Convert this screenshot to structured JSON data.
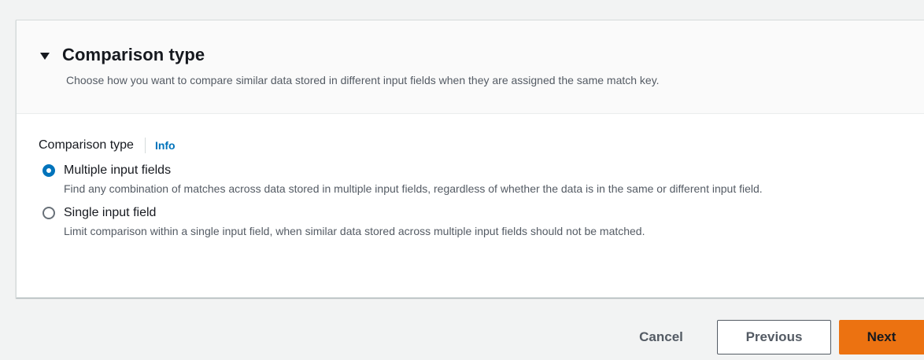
{
  "section": {
    "title": "Comparison type",
    "description": "Choose how you want to compare similar data stored in different input fields when they are assigned the same match key.",
    "expanded": true,
    "caret_icon": "caret-down-icon"
  },
  "field": {
    "label": "Comparison type",
    "info_link": "Info",
    "options": [
      {
        "label": "Multiple input fields",
        "description": "Find any combination of matches across data stored in multiple input fields, regardless of whether the data is in the same or different input field.",
        "selected": true
      },
      {
        "label": "Single input field",
        "description": "Limit comparison within a single input field, when similar data stored across multiple input fields should not be matched.",
        "selected": false
      }
    ]
  },
  "footer": {
    "cancel_label": "Cancel",
    "previous_label": "Previous",
    "next_label": "Next"
  },
  "colors": {
    "primary_button": "#ec7211",
    "link": "#0073bb",
    "radio_selected": "#0073bb"
  }
}
